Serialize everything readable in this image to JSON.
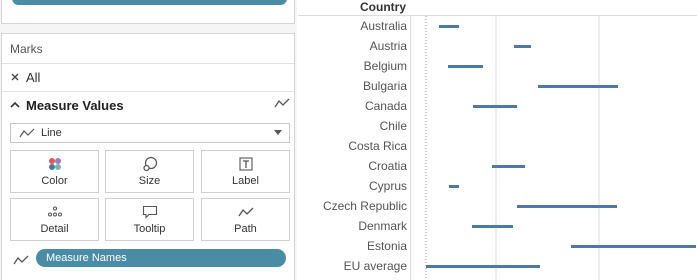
{
  "marks": {
    "title": "Marks",
    "all_label": "All",
    "measure_values_label": "Measure Values",
    "mark_type": "Line",
    "buttons": [
      {
        "label": "Color",
        "icon": "color-icon"
      },
      {
        "label": "Size",
        "icon": "size-icon"
      },
      {
        "label": "Label",
        "icon": "label-icon"
      },
      {
        "label": "Detail",
        "icon": "detail-icon"
      },
      {
        "label": "Tooltip",
        "icon": "tooltip-icon"
      },
      {
        "label": "Path",
        "icon": "path-icon"
      }
    ],
    "pill": "Measure Names"
  },
  "colors": {
    "pill": "#4a8ca6",
    "bar": "#4e79a7",
    "grid": "#dcdcdc"
  },
  "chart_data": {
    "type": "bar",
    "column_header": "Country",
    "categories": [
      "Australia",
      "Austria",
      "Belgium",
      "Bulgaria",
      "Canada",
      "Chile",
      "Costa Rica",
      "Croatia",
      "Cyprus",
      "Czech Republic",
      "Denmark",
      "Estonia",
      "EU average"
    ],
    "ranges": [
      [
        28,
        48
      ],
      [
        103,
        120
      ],
      [
        37,
        72
      ],
      [
        127,
        207
      ],
      [
        62,
        106
      ],
      null,
      null,
      [
        81,
        114
      ],
      [
        38,
        48
      ],
      [
        106,
        206
      ],
      [
        61,
        102
      ],
      [
        160,
        285
      ],
      [
        15,
        129
      ]
    ],
    "x_gridlines": [
      85,
      188,
      290
    ],
    "reference_line": 15
  }
}
